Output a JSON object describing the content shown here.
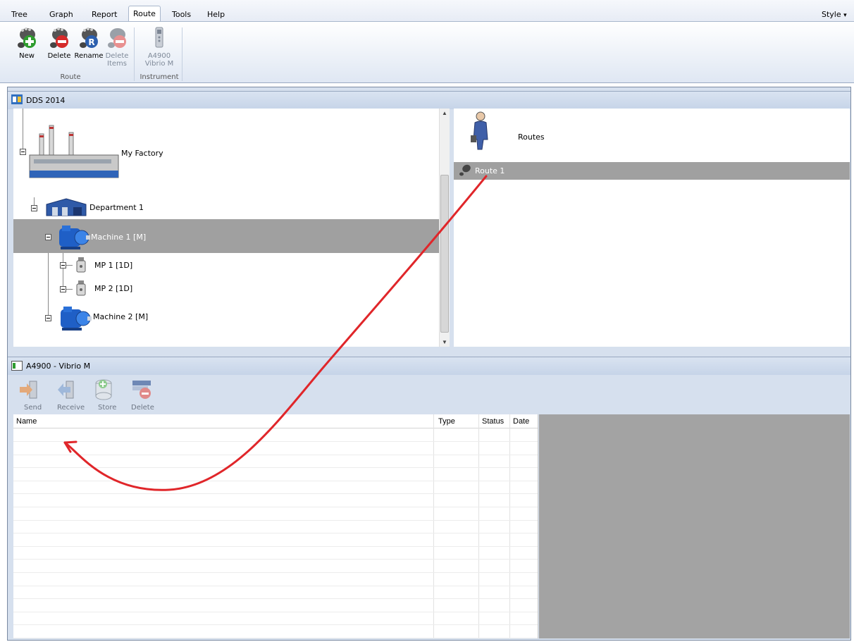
{
  "menu": {
    "tabs": [
      "Tree",
      "Graph",
      "Report",
      "Route",
      "Tools",
      "Help"
    ],
    "active": "Route",
    "style_label": "Style",
    "style_arrow": "▾"
  },
  "ribbon": {
    "route_group": {
      "label": "Route",
      "new": "New",
      "delete": "Delete",
      "rename": "Rename",
      "delete_items_1": "Delete",
      "delete_items_2": "Items"
    },
    "instrument_group": {
      "label": "Instrument",
      "line1": "A4900",
      "line2": "Vibrio M"
    }
  },
  "tree_panel": {
    "title": "DDS 2014",
    "nodes": {
      "factory": "My Factory",
      "department": "Department 1",
      "machine1": "Machine 1 [M]",
      "mp1": "MP 1 [1D]",
      "mp2": "MP 2 [1D]",
      "machine2": "Machine 2 [M]"
    }
  },
  "routes_panel": {
    "header": "Routes",
    "items": [
      "Route 1"
    ]
  },
  "instrument_panel": {
    "title": "A4900 - Vibrio M",
    "toolbar": {
      "send": "Send",
      "receive": "Receive",
      "store": "Store",
      "delete": "Delete"
    },
    "columns": {
      "name": "Name",
      "type": "Type",
      "status": "Status",
      "date": "Date"
    }
  },
  "colors": {
    "selection": "#a0a0a0",
    "arrow": "#e0262a",
    "panel_header": "#c6d4e8",
    "preview_gray": "#a3a3a3"
  }
}
